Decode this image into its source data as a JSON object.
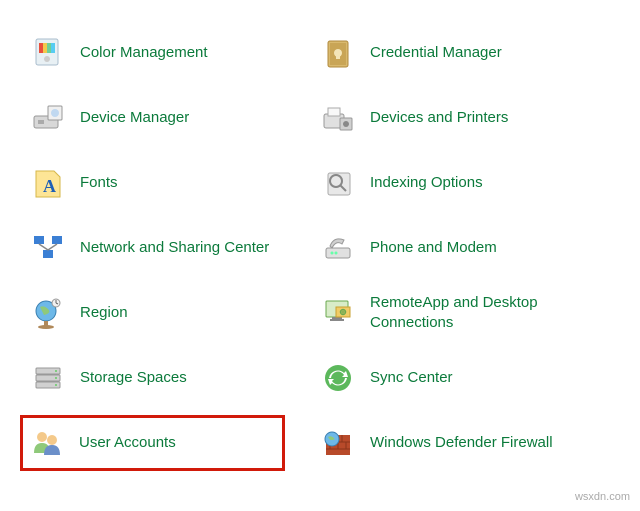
{
  "items": {
    "left": [
      {
        "label": "Color Management",
        "icon": "color-management"
      },
      {
        "label": "Device Manager",
        "icon": "device-manager"
      },
      {
        "label": "Fonts",
        "icon": "fonts"
      },
      {
        "label": "Network and Sharing Center",
        "icon": "network-sharing"
      },
      {
        "label": "Region",
        "icon": "region"
      },
      {
        "label": "Storage Spaces",
        "icon": "storage-spaces"
      },
      {
        "label": "User Accounts",
        "icon": "user-accounts",
        "highlighted": true
      }
    ],
    "right": [
      {
        "label": "Credential Manager",
        "icon": "credential-manager"
      },
      {
        "label": "Devices and Printers",
        "icon": "devices-printers"
      },
      {
        "label": "Indexing Options",
        "icon": "indexing-options"
      },
      {
        "label": "Phone and Modem",
        "icon": "phone-modem"
      },
      {
        "label": "RemoteApp and Desktop Connections",
        "icon": "remoteapp"
      },
      {
        "label": "Sync Center",
        "icon": "sync-center"
      },
      {
        "label": "Windows Defender Firewall",
        "icon": "defender-firewall"
      }
    ]
  },
  "watermark": "wsxdn.com"
}
